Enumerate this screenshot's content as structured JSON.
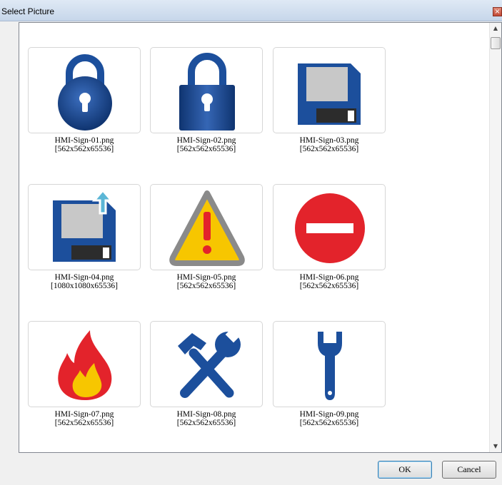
{
  "window": {
    "title": "Select Picture",
    "close_glyph": "×"
  },
  "scrollbar": {
    "up_glyph": "▲",
    "down_glyph": "▼"
  },
  "pictures": [
    {
      "name": "HMI-Sign-01.png",
      "info": "[562x562x65536]",
      "icon": "padlock-round-icon"
    },
    {
      "name": "HMI-Sign-02.png",
      "info": "[562x562x65536]",
      "icon": "padlock-square-icon"
    },
    {
      "name": "HMI-Sign-03.png",
      "info": "[562x562x65536]",
      "icon": "floppy-disk-icon"
    },
    {
      "name": "HMI-Sign-04.png",
      "info": "[1080x1080x65536]",
      "icon": "floppy-upload-icon"
    },
    {
      "name": "HMI-Sign-05.png",
      "info": "[562x562x65536]",
      "icon": "warning-triangle-icon"
    },
    {
      "name": "HMI-Sign-06.png",
      "info": "[562x562x65536]",
      "icon": "no-entry-icon"
    },
    {
      "name": "HMI-Sign-07.png",
      "info": "[562x562x65536]",
      "icon": "fire-icon"
    },
    {
      "name": "HMI-Sign-08.png",
      "info": "[562x562x65536]",
      "icon": "tools-icon"
    },
    {
      "name": "HMI-Sign-09.png",
      "info": "[562x562x65536]",
      "icon": "wrench-icon"
    }
  ],
  "colors": {
    "blue": "#1c4f9c",
    "blue_dark": "#0f3470",
    "yellow": "#f7c600",
    "red": "#e3232b",
    "gray": "#c8c8c8",
    "teal": "#5bb6d6"
  },
  "buttons": {
    "ok": "OK",
    "cancel": "Cancel"
  }
}
